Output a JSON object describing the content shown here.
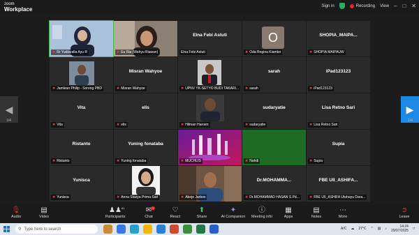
{
  "app": {
    "brand_line1": "zoom",
    "brand_line2": "Workplace"
  },
  "topbar": {
    "signin": "Sign in",
    "recording": "Recording",
    "view": "View"
  },
  "pager": {
    "left_num": "1/4",
    "right_num": "1/4"
  },
  "tiles": {
    "t1": {
      "label": "Rr Yudisvalla Ayu R"
    },
    "t2": {
      "label": "Eu Ria (Wahyu Riawan)"
    },
    "t3": {
      "name": "Elna Febi Astuti",
      "label": "Elna Febi Astuti"
    },
    "t4": {
      "avatar": "O",
      "label": "Oda Regina Kiambo"
    },
    "t5": {
      "name": "SHOPIA_MAIPA...",
      "label": "SHOPIA MAIPAUW"
    },
    "t6": {
      "label": "Jamlean Philip - Sorong PBD"
    },
    "t7": {
      "name": "Misran Wahyoe",
      "label": "Misran Wahyoe"
    },
    "t8": {
      "label": "UPNV YK-SETYO BUDI TAKARI..."
    },
    "t9": {
      "name": "sarah",
      "label": "sarah"
    },
    "t10": {
      "name": "iPad123123",
      "label": "iPad123123"
    },
    "t11": {
      "name": "Vita",
      "label": "Vita"
    },
    "t12": {
      "name": "elis",
      "label": "elis"
    },
    "t13": {
      "label": "Hilman Haroen"
    },
    "t14": {
      "name": "sudaryatie",
      "label": "sudaryatie"
    },
    "t15": {
      "name": "Lisa Retno Sari",
      "label": "Lisa Retno Sari"
    },
    "t16": {
      "name": "Ristanto",
      "label": "Ristanto"
    },
    "t17": {
      "name": "Yuning fonataba",
      "label": "Yuning fonataba"
    },
    "t18": {
      "label": "MUCHLIS"
    },
    "t19": {
      "label": "Nahdi"
    },
    "t20": {
      "name": "Supia",
      "label": "Supia"
    },
    "t21": {
      "name": "Yunisca",
      "label": "Yunisca"
    },
    "t22": {
      "label": "Anna Stasya Prima Sari"
    },
    "t23": {
      "label": "Abeje Jarbos"
    },
    "t24": {
      "name": "Dr.MOHAMMA...",
      "label": "Dr.MOHAMMAD HASAN S.Pd..."
    },
    "t25": {
      "name": "FBE UII_ASHIFA...",
      "label": "FBE UII_ASHIFA Utuhayu Dara..."
    }
  },
  "toolbar": {
    "audio": "Audio",
    "video": "Video",
    "participants": "Participants",
    "participants_count": "81",
    "chat": "Chat",
    "chat_badge": "1",
    "react": "React",
    "share": "Share",
    "ai": "AI Companion",
    "meeting_info": "Meeting info",
    "apps": "Apps",
    "notes": "Notes",
    "more": "More",
    "leave": "Leave"
  },
  "taskbar": {
    "search_placeholder": "Type here to search",
    "ime": "A/C",
    "temp": "27°C",
    "time": "14:24",
    "date": "29/07/2025"
  },
  "colors": {
    "accent": "#1e88e5",
    "record": "#e02828",
    "speaking": "#39b54a"
  }
}
